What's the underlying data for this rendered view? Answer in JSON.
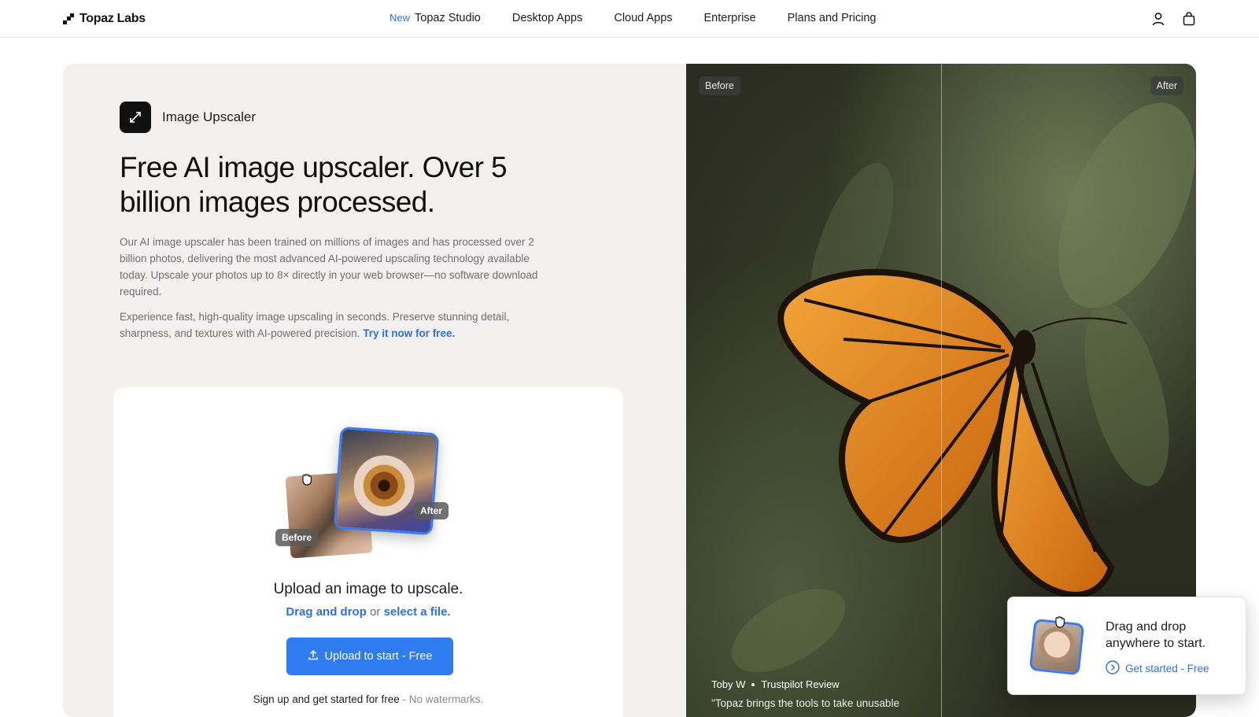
{
  "header": {
    "logo_text": "Topaz Labs",
    "nav": [
      {
        "badge": "New",
        "label": "Topaz Studio"
      },
      {
        "label": "Desktop Apps"
      },
      {
        "label": "Cloud Apps"
      },
      {
        "label": "Enterprise"
      },
      {
        "label": "Plans and Pricing"
      }
    ],
    "icons": [
      "user-icon",
      "shopping-bag-icon"
    ]
  },
  "hero": {
    "tool_name": "Image Upscaler",
    "headline": "Free AI image upscaler. Over 5 billion images processed.",
    "paragraph1": "Our AI image upscaler has been trained on millions of images and has processed over 2 billion photos, delivering the most advanced AI-powered upscaling technology available today. Upscale your photos up to 8× directly in your web browser—no software download required.",
    "paragraph2_text": "Experience fast, high-quality image upscaling in seconds. Preserve stunning detail, sharpness, and textures with AI-powered precision.",
    "paragraph2_link": "Try it now for free."
  },
  "upload": {
    "before_tag": "Before",
    "after_tag": "After",
    "title": "Upload an image to upscale.",
    "drag_link": "Drag and drop",
    "or_text": "or",
    "select_link": "select a file.",
    "button_label": "Upload to start - Free",
    "note_main": "Sign up and get started for free",
    "note_muted": "- No watermarks."
  },
  "compare": {
    "before_label": "Before",
    "after_label": "After",
    "reviewer": "Toby W",
    "review_source": "Trustpilot Review",
    "quote": "\"Topaz brings the tools to take unusable"
  },
  "popup": {
    "title": "Drag and drop anywhere to start.",
    "link": "Get started - Free"
  },
  "colors": {
    "accent": "#2f7bf0",
    "link": "#2f6fdf",
    "hero_bg": "#f3f1ef"
  }
}
